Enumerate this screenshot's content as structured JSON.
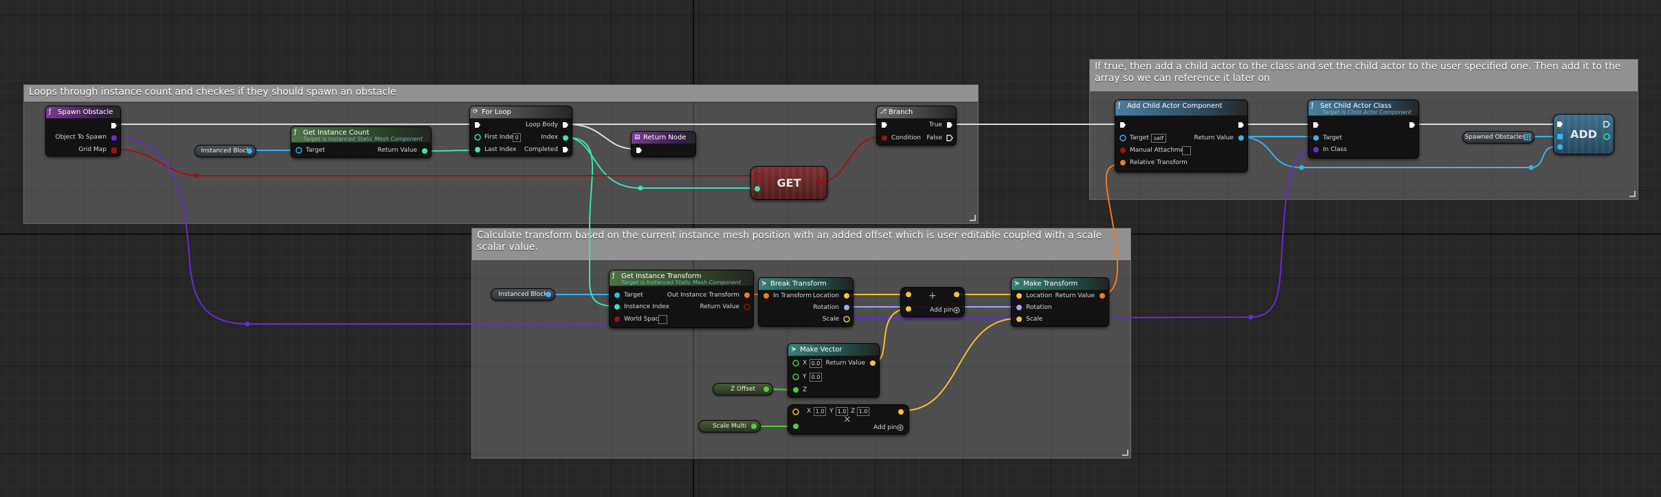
{
  "comments": {
    "loop": "Loops through instance count and checkes if they should spawn an obstacle",
    "child": "If true, then add a child actor to the class and set the child actor to the user specified one. Then add it to the array so we can reference it later on",
    "transform": "Calculate transform based on the current instance mesh position with an added offset which is user editable coupled with a scale scalar value."
  },
  "nodes": {
    "spawn_obstacle": {
      "title": "Spawn Obstacle",
      "pin_object": "Object To Spawn",
      "pin_grid": "Grid Map"
    },
    "instanced_block_1": {
      "label": "Instanced Block"
    },
    "get_instance_count": {
      "title": "Get Instance Count",
      "subtitle": "Target is Instanced Static Mesh Component",
      "pin_target": "Target",
      "pin_return": "Return Value"
    },
    "for_loop": {
      "title": "For Loop",
      "pin_first": "First Index",
      "first_value": "0",
      "pin_last": "Last Index",
      "pin_body": "Loop Body",
      "pin_index": "Index",
      "pin_completed": "Completed"
    },
    "return_node": {
      "title": "Return Node"
    },
    "get": {
      "label": "GET"
    },
    "branch": {
      "title": "Branch",
      "pin_condition": "Condition",
      "pin_true": "True",
      "pin_false": "False"
    },
    "add_child": {
      "title": "Add Child Actor Component",
      "pin_target": "Target",
      "target_value": "self",
      "pin_manual": "Manual Attachment",
      "pin_relative": "Relative Transform",
      "pin_return": "Return Value"
    },
    "set_child": {
      "title": "Set Child Actor Class",
      "subtitle": "Target is Child Actor Component",
      "pin_target": "Target",
      "pin_class": "In Class"
    },
    "spawned_obstacles": {
      "label": "Spawned Obstacles"
    },
    "add": {
      "label": "ADD"
    },
    "instanced_block_2": {
      "label": "Instanced Block"
    },
    "get_instance_transform": {
      "title": "Get Instance Transform",
      "subtitle": "Target is Instanced Static Mesh Component",
      "pin_target": "Target",
      "pin_index": "Instance Index",
      "pin_world": "World Space",
      "pin_out": "Out Instance Transform",
      "pin_return": "Return Value"
    },
    "break_transform": {
      "title": "Break Transform",
      "pin_in": "In Transform",
      "pin_location": "Location",
      "pin_rotation": "Rotation",
      "pin_scale": "Scale"
    },
    "add_vec": {
      "symbol": "+",
      "add_pin": "Add pin"
    },
    "make_transform": {
      "title": "Make Transform",
      "pin_location": "Location",
      "pin_rotation": "Rotation",
      "pin_scale": "Scale",
      "pin_return": "Return Value"
    },
    "make_vector": {
      "title": "Make Vector",
      "pin_x": "X",
      "x_value": "0.0",
      "pin_y": "Y",
      "y_value": "0.0",
      "pin_z": "Z",
      "pin_return": "Return Value"
    },
    "z_offset": {
      "label": "Z Offset"
    },
    "scale_multi": {
      "label": "Scale Multi"
    },
    "mult_vec": {
      "x_label": "X",
      "x_value": "1.0",
      "y_label": "Y",
      "y_value": "1.0",
      "z_label": "Z",
      "z_value": "1.0",
      "symbol": "×",
      "add_pin": "Add pin"
    }
  },
  "colors": {
    "exec": "#ffffff",
    "object": "#3ab2ee",
    "integer": "#3ee3b1",
    "boolean": "#a01010",
    "vector": "#f5c231",
    "transform": "#f27a25",
    "class": "#6a2bd6",
    "rotator": "#a0a6ff"
  },
  "icons": [
    "function-icon",
    "loop-icon",
    "branch-icon",
    "return-icon",
    "make-struct-icon"
  ]
}
